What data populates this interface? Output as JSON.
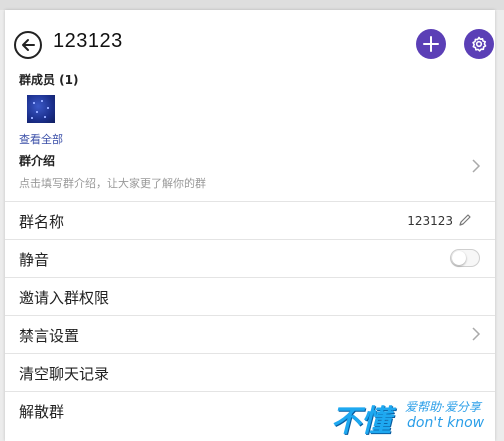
{
  "header": {
    "title": "123123",
    "back_icon": "back-arrow-icon",
    "add_icon": "plus-icon",
    "settings_icon": "gear-icon",
    "accent_color": "#5b3fb6"
  },
  "members": {
    "title": "群成员 (1)",
    "view_all": "查看全部"
  },
  "intro": {
    "title": "群介绍",
    "hint": "点击填写群介绍，让大家更了解你的群"
  },
  "rows": {
    "group_name": {
      "label": "群名称",
      "value": "123123"
    },
    "mute": {
      "label": "静音",
      "enabled": false
    },
    "invite_permission": {
      "label": "邀请入群权限"
    },
    "ban_settings": {
      "label": "禁言设置"
    },
    "clear_history": {
      "label": "清空聊天记录"
    },
    "dissolve": {
      "label": "解散群"
    }
  },
  "watermark": {
    "big": "不懂",
    "top": "爱帮助·爱分享",
    "bottom": "don't know"
  }
}
